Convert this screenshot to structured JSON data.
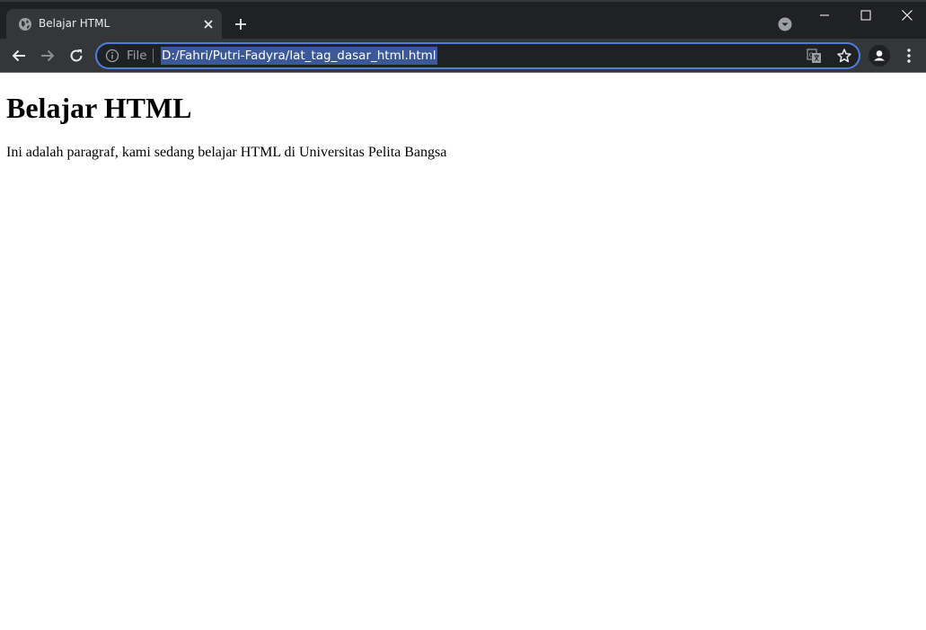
{
  "browser": {
    "tab": {
      "title": "Belajar HTML",
      "favicon": "globe-icon"
    },
    "toolbar": {
      "scheme_label": "File",
      "url": "D:/Fahri/Putri-Fadyra/lat_tag_dasar_html.html"
    },
    "colors": {
      "tabstrip_bg": "#202124",
      "toolbar_bg": "#35363a",
      "omnibox_focus_border": "#4a7fdc",
      "url_selection_bg": "#3b5998"
    }
  },
  "page": {
    "heading": "Belajar HTML",
    "paragraph": "Ini adalah paragraf, kami sedang belajar HTML di Universitas Pelita Bangsa"
  }
}
